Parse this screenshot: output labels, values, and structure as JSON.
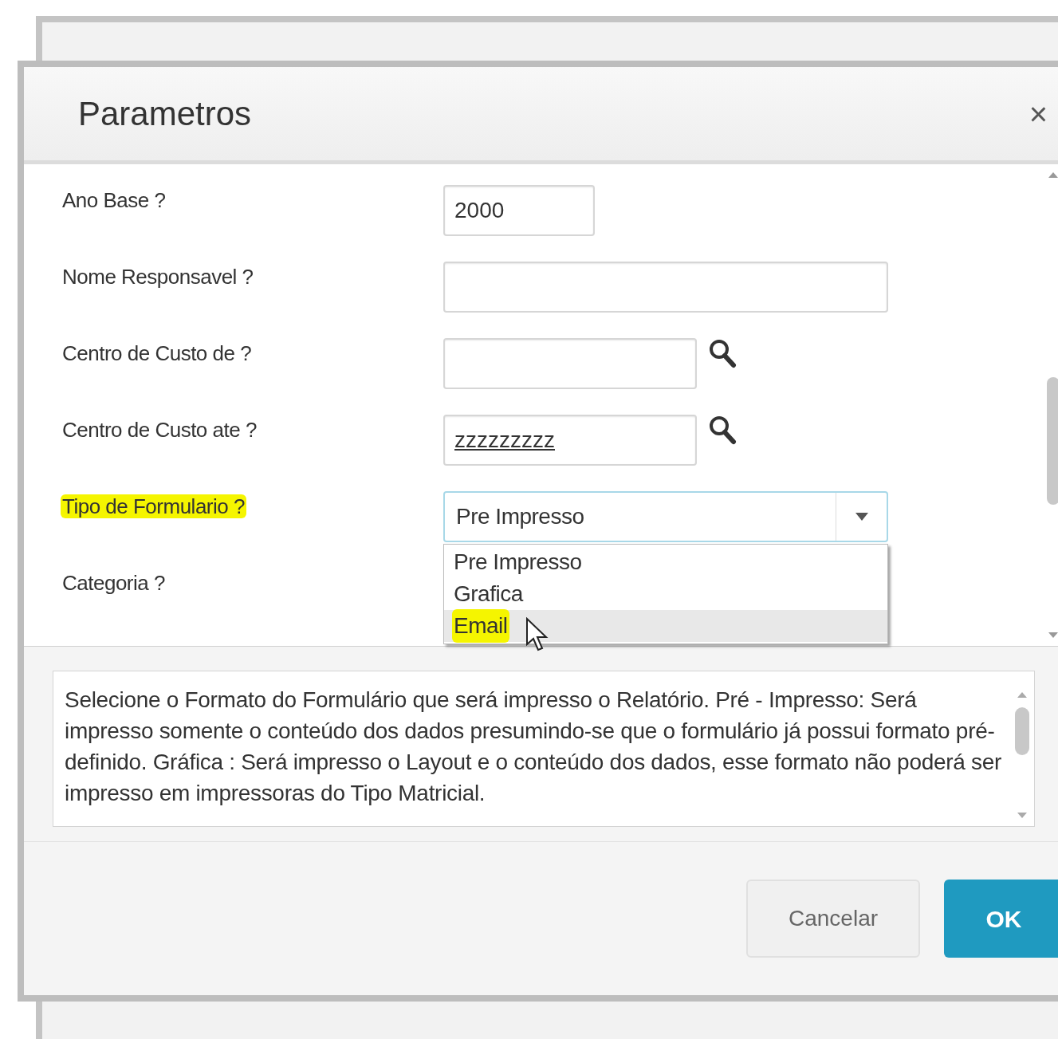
{
  "dialog": {
    "title": "Parametros",
    "close": "×"
  },
  "fields": [
    {
      "kind": "short_text",
      "label": "Ano Base ?",
      "value": "2000",
      "highlighted": false
    },
    {
      "kind": "long_text",
      "label": "Nome Responsavel ?",
      "highlighted": false
    },
    {
      "kind": "lookup",
      "label": "Centro de Custo de ?",
      "highlighted": false
    },
    {
      "kind": "lookup",
      "label": "Centro de Custo ate ?",
      "value": "zzzzzzzzz",
      "highlighted": false
    },
    {
      "kind": "select",
      "label": "Tipo de Formulario ?",
      "value": "Pre Impresso",
      "expanded": true,
      "highlighted": true,
      "options": [
        {
          "label": "Pre Impresso",
          "hovered": false,
          "highlighted": false
        },
        {
          "label": "Grafica",
          "hovered": false,
          "highlighted": false
        },
        {
          "label": "Email",
          "hovered": true,
          "highlighted": true
        }
      ]
    },
    {
      "kind": "empty",
      "label": "Categoria ?",
      "highlighted": false
    }
  ],
  "help_text": "Selecione o Formato do Formulário que será impresso o Relatório. Pré - Impresso: Será impresso somente o conteúdo dos dados presumindo-se que o formulário já possui formato pré-definido. Gráfica : Será  impresso o Layout e o conteúdo dos dados, esse formato não poderá ser impresso em impressoras do Tipo Matricial.",
  "buttons": [
    {
      "label": "Cancelar",
      "kind": "secondary"
    },
    {
      "label": "OK",
      "kind": "primary"
    }
  ]
}
